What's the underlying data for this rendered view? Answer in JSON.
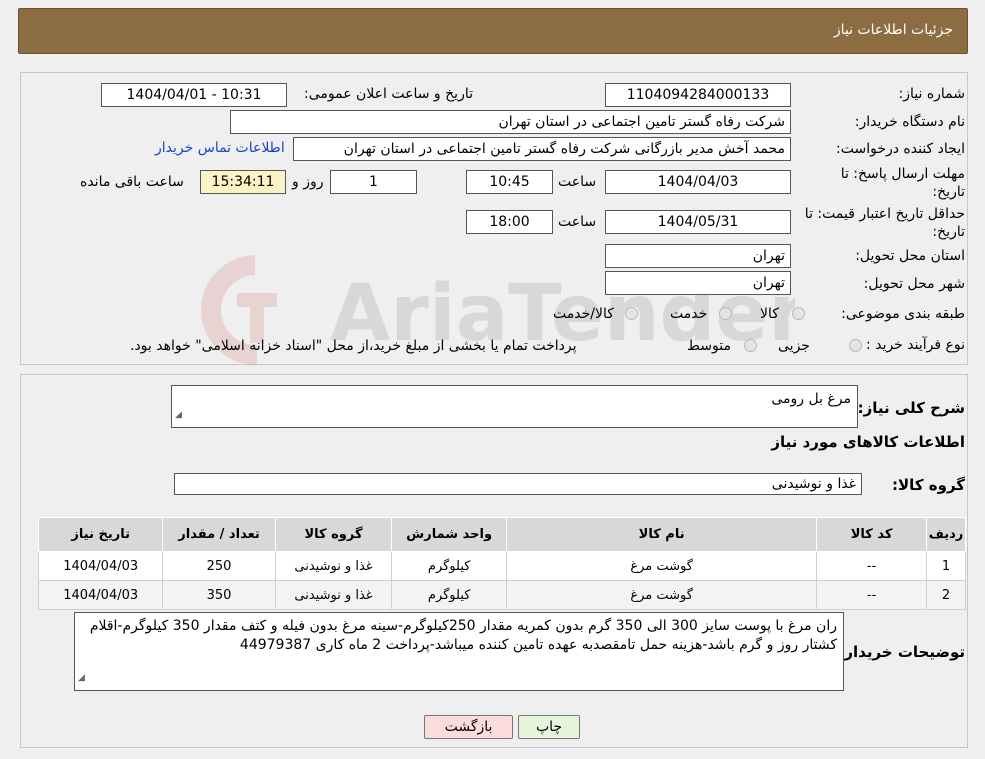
{
  "header": {
    "title": "جزئیات اطلاعات نیاز"
  },
  "info": {
    "need_number_label": "شماره نیاز:",
    "need_number": "1104094284000133",
    "announce_label": "تاریخ و ساعت اعلان عمومی:",
    "announce_value": "1404/04/01 - 10:31",
    "buyer_org_label": "نام دستگاه خریدار:",
    "buyer_org": "شرکت رفاه گستر تامین اجتماعی در استان تهران",
    "creator_label": "ایجاد کننده درخواست:",
    "creator": "محمد آخش مدیر بازرگانی شرکت رفاه گستر تامین اجتماعی در استان تهران",
    "contact_link": "اطلاعات تماس خریدار",
    "deadline_label": "مهلت ارسال پاسخ: تا تاریخ:",
    "deadline_date": "1404/04/03",
    "time_label": "ساعت",
    "deadline_time": "10:45",
    "days_value": "1",
    "days_label": "روز و",
    "remaining_time": "15:34:11",
    "remaining_label": "ساعت باقی مانده",
    "validity_label": "حداقل تاریخ اعتبار قیمت: تا تاریخ:",
    "validity_date": "1404/05/31",
    "validity_time": "18:00",
    "province_label": "استان محل تحویل:",
    "province": "تهران",
    "city_label": "شهر محل تحویل:",
    "city": "تهران",
    "category_label": "طبقه بندی موضوعی:",
    "category_options": [
      "کالا",
      "خدمت",
      "کالا/خدمت"
    ],
    "process_label": "نوع فرآیند خرید :",
    "process_options": [
      "جزیی",
      "متوسط"
    ],
    "process_note": "پرداخت تمام یا بخشی از مبلغ خرید،از محل \"اسناد خزانه اسلامی\" خواهد بود."
  },
  "need": {
    "desc_label": "شرح کلی نیاز:",
    "desc_value": "مرغ بل رومی",
    "goods_title": "اطلاعات کالاهای مورد نیاز",
    "group_label": "گروه کالا:",
    "group_value": "غذا و نوشیدنی"
  },
  "table": {
    "headers": [
      "ردیف",
      "کد کالا",
      "نام کالا",
      "واحد شمارش",
      "گروه کالا",
      "تعداد / مقدار",
      "تاریخ نیاز"
    ],
    "rows": [
      [
        "1",
        "--",
        "گوشت مرغ",
        "کیلوگرم",
        "غذا و نوشیدنی",
        "250",
        "1404/04/03"
      ],
      [
        "2",
        "--",
        "گوشت مرغ",
        "کیلوگرم",
        "غذا و نوشیدنی",
        "350",
        "1404/04/03"
      ]
    ]
  },
  "buyer_notes": {
    "label": "توضیحات خریدار:",
    "text": "ران مرغ با پوست سایز 300 الی 350 گرم بدون کمریه مقدار 250کیلوگرم-سینه مرغ بدون فیله و کتف مقدار 350 کیلوگرم-اقلام کشتار روز و گرم باشد-هزینه حمل تامقصدبه عهده تامین کننده میباشد-پرداخت 2 ماه کاری 44979387"
  },
  "buttons": {
    "print": "چاپ",
    "back": "بازگشت"
  },
  "watermark": "AriaTender.neT",
  "colors": {
    "title_bg": "#8b6d41",
    "back_bg": "#fbdcdc",
    "print_bg": "#e6f6dc",
    "link": "#1a44c8"
  }
}
